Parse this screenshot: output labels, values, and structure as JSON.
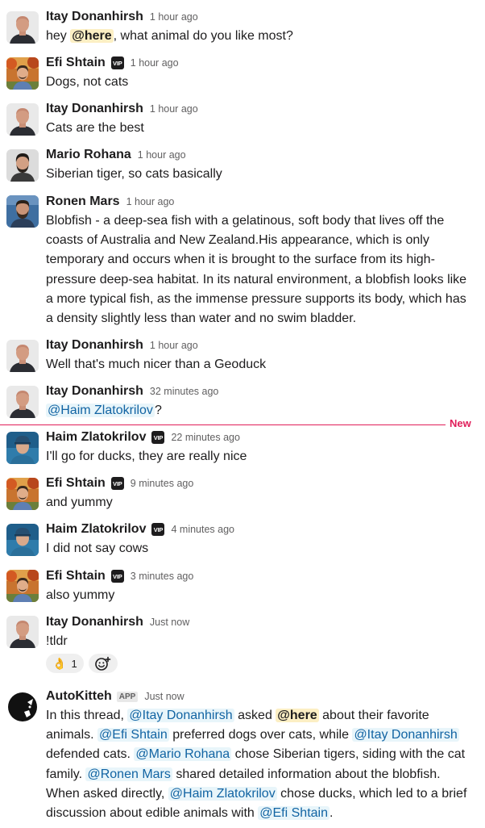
{
  "messages": [
    {
      "name": "Itay Donanhirsh",
      "time": "1 hour ago",
      "pre": "hey ",
      "mention": "@here",
      "post": ", what animal do you like most?"
    },
    {
      "name": "Efi Shtain",
      "vip": "VIP",
      "time": "1 hour ago",
      "text": "Dogs, not cats"
    },
    {
      "name": "Itay Donanhirsh",
      "time": "1 hour ago",
      "text": "Cats are the best"
    },
    {
      "name": "Mario Rohana",
      "time": "1 hour ago",
      "text": "Siberian tiger, so cats basically"
    },
    {
      "name": "Ronen Mars",
      "time": "1 hour ago",
      "line1": "Blobfish - a deep-sea fish with a gelatinous, soft body that lives off the",
      "line2": "coasts of Australia and New Zealand.His appearance, which is only",
      "line3": "temporary and occurs when it is brought to the surface from its high-",
      "line4": "pressure deep-sea habitat. In its natural environment, a blobfish looks like",
      "line5": "a more typical fish, as the immense pressure supports its body, which has",
      "line6": "a density slightly less than water and no swim bladder."
    },
    {
      "name": "Itay Donanhirsh",
      "time": "1 hour ago",
      "text": "Well that's much nicer than a Geoduck"
    },
    {
      "name": "Itay Donanhirsh",
      "time": "32 minutes ago",
      "mention": "@Haim Zlatokrilov",
      "post": "?"
    },
    {
      "name": "Haim Zlatokrilov",
      "vip": "VIP",
      "time": "22 minutes ago",
      "text": "I'll go for ducks, they are really nice"
    },
    {
      "name": "Efi Shtain",
      "vip": "VIP",
      "time": "9 minutes ago",
      "text": "and yummy"
    },
    {
      "name": "Haim Zlatokrilov",
      "vip": "VIP",
      "time": "4 minutes ago",
      "text": "I did not say cows"
    },
    {
      "name": "Efi Shtain",
      "vip": "VIP",
      "time": "3 minutes ago",
      "text": "also yummy"
    },
    {
      "name": "Itay Donanhirsh",
      "time": "Just now",
      "text": "!tldr"
    },
    {
      "name": "AutoKitteh",
      "badge": "APP",
      "time": "Just now",
      "s1": "In this thread, ",
      "m1": "@Itay Donanhirsh",
      "s2": " asked ",
      "m2": "@here",
      "s3": " about their favorite",
      "s4": "animals. ",
      "m3": "@Efi Shtain",
      "s5": " preferred dogs over cats, while ",
      "m4": "@Itay Donanhirsh",
      "s6": "defended cats. ",
      "m5": "@Mario Rohana",
      "s7": " chose Siberian tigers, siding with the cat",
      "s8": "family. ",
      "m6": "@Ronen Mars",
      "s9": " shared detailed information about the blobfish.",
      "s10": "When asked directly, ",
      "m7": "@Haim Zlatokrilov",
      "s11": " chose ducks, which led to a brief",
      "s12": "discussion about edible animals with ",
      "m8": "@Efi Shtain",
      "s13": "."
    }
  ],
  "divider": {
    "label": "New"
  },
  "reaction": {
    "emoji": "👌",
    "count": "1",
    "icon": "add-reaction-icon"
  },
  "colors": {
    "mention_bg": "#e8f5fa",
    "mention_fg": "#1264a3",
    "here_bg": "#fcefc4",
    "new": "#e01e5a"
  }
}
